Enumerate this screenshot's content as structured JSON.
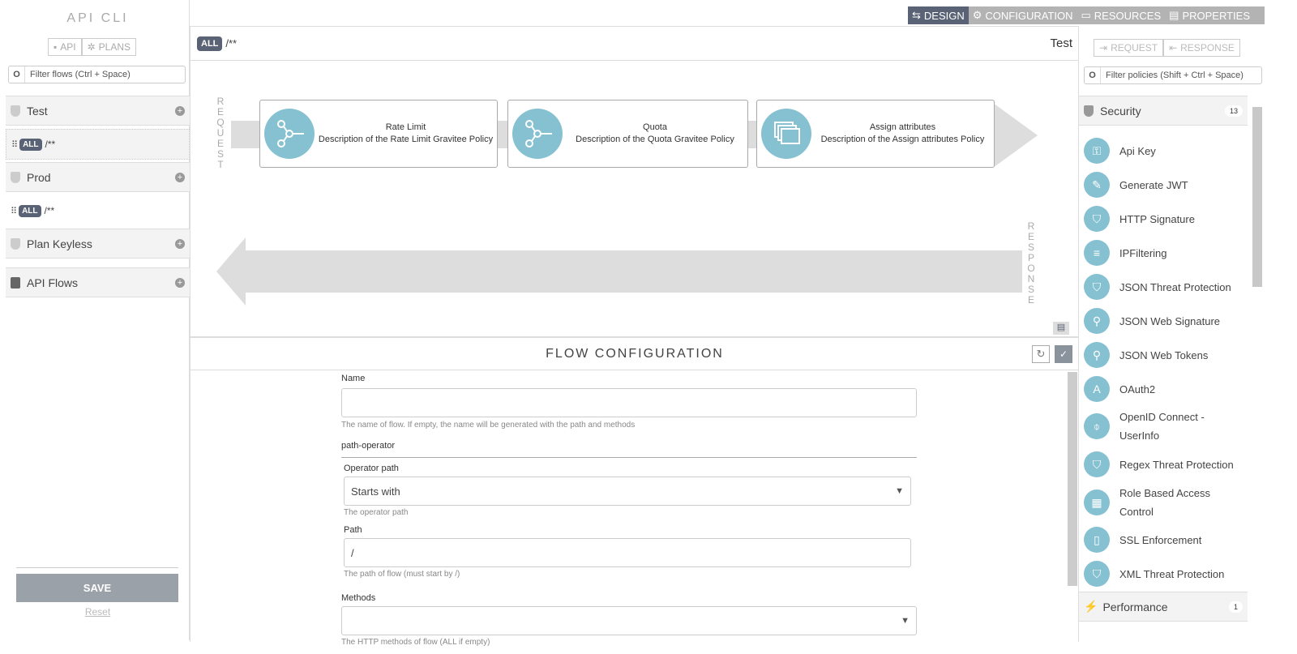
{
  "left": {
    "title": "API CLI",
    "api_btn": "API",
    "plans_btn": "PLANS",
    "filter_placeholder": "Filter flows (Ctrl + Space)",
    "groups": [
      {
        "name": "Test",
        "flows": [
          {
            "method": "ALL",
            "path": "/**"
          }
        ]
      },
      {
        "name": "Prod",
        "flows": [
          {
            "method": "ALL",
            "path": "/**"
          }
        ]
      },
      {
        "name": "Plan Keyless",
        "flows": []
      },
      {
        "name": "API Flows",
        "flows": []
      }
    ],
    "save": "SAVE",
    "reset": "Reset"
  },
  "tabs": [
    {
      "label": "DESIGN",
      "active": true
    },
    {
      "label": "CONFIGURATION"
    },
    {
      "label": "RESOURCES"
    },
    {
      "label": "PROPERTIES"
    }
  ],
  "center": {
    "method": "ALL",
    "path": "/**",
    "flow_name": "Test",
    "request_label": "REQUEST",
    "response_label": "RESPONSE",
    "policies": [
      {
        "name": "Rate Limit",
        "desc": "Description of the Rate Limit Gravitee Policy",
        "icon": "share-icon"
      },
      {
        "name": "Quota",
        "desc": "Description of the Quota Gravitee Policy",
        "icon": "share-icon"
      },
      {
        "name": "Assign attributes",
        "desc": "Description of the Assign attributes Policy",
        "icon": "windows-icon"
      }
    ],
    "config_title": "FLOW CONFIGURATION",
    "form": {
      "name_label": "Name",
      "name_value": "",
      "name_help": "The name of flow. If empty, the name will be generated with the path and methods",
      "section": "path-operator",
      "operator_label": "Operator path",
      "operator_value": "Starts with",
      "operator_help": "The operator path",
      "path_label": "Path",
      "path_value": "/",
      "path_help": "The path of flow (must start by /)",
      "methods_label": "Methods",
      "methods_value": "",
      "methods_help": "The HTTP methods of flow (ALL if empty)"
    }
  },
  "right": {
    "request_btn": "REQUEST",
    "response_btn": "RESPONSE",
    "filter_placeholder": "Filter policies (Shift + Ctrl + Space)",
    "security": {
      "label": "Security",
      "count": "13",
      "items": [
        "Api Key",
        "Generate JWT",
        "HTTP Signature",
        "IPFiltering",
        "JSON Threat Protection",
        "JSON Web Signature",
        "JSON Web Tokens",
        "OAuth2",
        "OpenID Connect - UserInfo",
        "Regex Threat Protection",
        "Role Based Access Control",
        "SSL Enforcement",
        "XML Threat Protection"
      ]
    },
    "performance": {
      "label": "Performance",
      "count": "1"
    }
  },
  "colors": {
    "accent": "#5a6375",
    "policy_icon": "#86c1d1",
    "tabbar": "#b3b3b3"
  }
}
